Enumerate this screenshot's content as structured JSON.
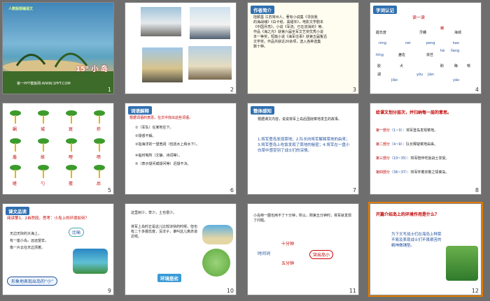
{
  "slides": [
    {
      "n": "1",
      "title": "15° 小 岛",
      "footer": "第一PPT模板网-WWW.1PPT.COM",
      "tag": "人教版部编语文"
    },
    {
      "n": "2"
    },
    {
      "n": "3",
      "tag": "作者简介",
      "lines": [
        "陆颖墨 江苏常州人。著有小说集《寻找我",
        "的海战魂》《白卡纸、黑甜年》，电影文学剧本",
        "《中国月亮》，小说《军流，已在流淌的》等。",
        "作品《海之光》获第六届全军文艺奖优秀小说",
        "本一等奖，短篇小说《海军往事》获第五届鲁迅",
        "文学奖。作品共获近20余项，选入各种选集",
        "数十种。"
      ]
    },
    {
      "n": "4",
      "tag": "字词认记",
      "sub": "读一读",
      "words": [
        "握氏度",
        "牙鲰",
        "螭",
        "海城",
        "ning",
        "nei",
        "peng",
        "kao",
        "hǐng",
        "蛊佐",
        "茯芑",
        "hé",
        "lǐang",
        "胶",
        "犬",
        "yǒu",
        "jiàn",
        "盼",
        "睁",
        "嘤",
        "湖",
        "jiǎo",
        "yáo"
      ]
    },
    {
      "n": "5",
      "chars": [
        "蜗",
        "城",
        "斑",
        "疥",
        "盾",
        "故",
        "哩",
        "喷",
        "嗟",
        "勺",
        "搅",
        "后"
      ]
    },
    {
      "n": "6",
      "tag": "词语解释",
      "intro": "根据词语的意思，在文中找出这些词语。",
      "items": [
        "①（军队）在某地住下。",
        "②疑惑不解。",
        "③指海洋的一望宽阔（包括水上和水下）。",
        "④临时哨所（文静、诗词等）。",
        "⑤（表示疑问或疑问等）迟疑不决。"
      ]
    },
    {
      "n": "7",
      "tag": "整体感知",
      "body": "根据课文内容，说说将军上岛后围绕菜地发生的故事。",
      "answer": "1.将军登岛发现菜地；2.队长向将军解释菜地的由来；3.将军登岛上吃饭发现了菜地的秘密；4.将军在一盘小白菜中感受到了战士们的深情。"
    },
    {
      "n": "8",
      "heading": "给课文划分层次，并归纳每一层的意思。",
      "parts": [
        {
          "label": "第一部分",
          "range": "（1~3）",
          "text": "：将军登岛发现菜地。"
        },
        {
          "label": "第二部分",
          "range": "（4~9）",
          "text": "：队长释疑菜地由来。"
        },
        {
          "label": "第三部分",
          "range": "（10~35）",
          "text": "：将军陪伴吃饭战士享受。"
        },
        {
          "label": "第四部分",
          "range": "（36~37）",
          "text": "：将军怀着崇敬之情离岛。"
        }
      ]
    },
    {
      "n": "9",
      "tag": "课文品读",
      "q": "阅读第1、2自然段，思考：小岛上的环境如何？",
      "poem": [
        "无边无际的大海上，",
        "有一座小岛，远远望去，",
        "像一片云在天边漂着。"
      ],
      "bubble": "比喻",
      "foot": "形象地表现出岛的“小”"
    },
    {
      "n": "10",
      "lines": [
        "这里树少，草少，土也很少。",
        "将军上岛时正是这儿比较凉快的时候，但也有二十多摄氏度，没法子，谁叫这儿离赤道近呢。"
      ],
      "tag": "环境恶劣"
    },
    {
      "n": "11",
      "body": "小岛特一圈也用不了十分钟，所以，刚第五分钟时，将军就发现了问题。",
      "a": "十分钟",
      "b": "五分钟",
      "c": "时间词",
      "d": "突出岛小"
    },
    {
      "n": "12",
      "heading": "开篇介绍岛上的环境作用是什么？",
      "answer": "为下文写战士们在海岛上种菜不易及表现战士们不畏艰苦的精神做铺垫。"
    }
  ]
}
